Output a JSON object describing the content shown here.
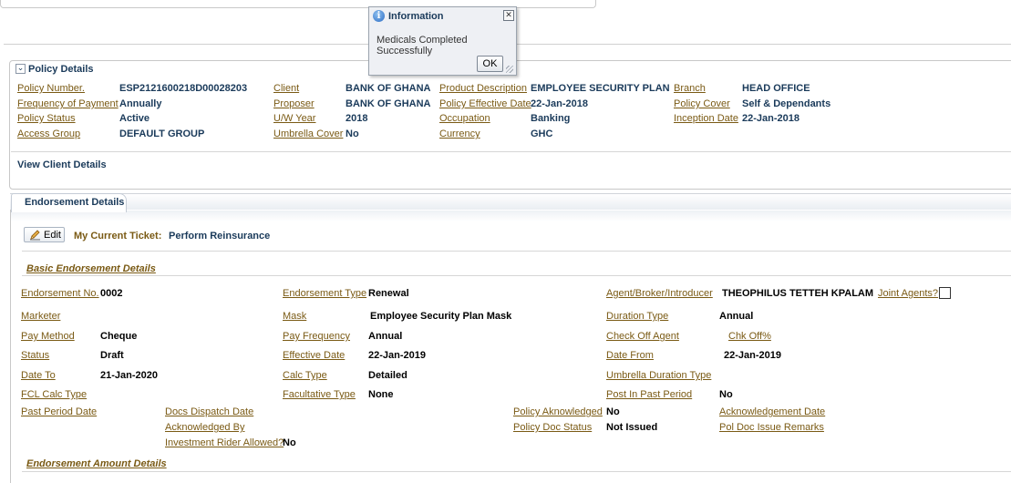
{
  "dialog": {
    "title": "Information",
    "message": "Medicals Completed Successfully",
    "ok_label": "OK",
    "close_glyph": "✕",
    "info_glyph": "i"
  },
  "policy_details": {
    "title": "Policy Details",
    "toggle_glyph": "⌄",
    "fields": {
      "policy_number": {
        "label": "Policy Number.",
        "value": "ESP2121600218D00028203"
      },
      "frequency_of_payment": {
        "label": "Frequency of Payment",
        "value": "Annually"
      },
      "policy_status": {
        "label": "Policy Status",
        "value": "Active"
      },
      "access_group": {
        "label": "Access Group",
        "value": "DEFAULT GROUP"
      },
      "client": {
        "label": "Client",
        "value": "BANK OF GHANA"
      },
      "proposer": {
        "label": "Proposer",
        "value": "BANK OF GHANA"
      },
      "uw_year": {
        "label": "U/W Year",
        "value": "2018"
      },
      "umbrella_cover": {
        "label": "Umbrella Cover",
        "value": "No"
      },
      "product_description": {
        "label": "Product Description",
        "value": "EMPLOYEE SECURITY PLAN"
      },
      "policy_effective_date": {
        "label": "Policy Effective Date",
        "value": "22-Jan-2018"
      },
      "occupation": {
        "label": "Occupation",
        "value": "Banking"
      },
      "currency": {
        "label": "Currency",
        "value": "GHC"
      },
      "branch": {
        "label": "Branch",
        "value": "HEAD OFFICE"
      },
      "policy_cover": {
        "label": "Policy Cover",
        "value": "Self & Dependants"
      },
      "inception_date": {
        "label": "Inception Date",
        "value": "22-Jan-2018"
      }
    },
    "view_client_link": "View Client Details"
  },
  "endorsement": {
    "tab_label": "Endorsement Details",
    "edit_label": "Edit",
    "ticket_label": "My Current Ticket:",
    "ticket_value": "Perform Reinsurance",
    "basic_title": "Basic Endorsement Details",
    "amount_title": "Endorsement Amount Details",
    "fields": {
      "endorsement_no": {
        "label": "Endorsement No.",
        "value": "0002"
      },
      "marketer": {
        "label": "Marketer",
        "value": ""
      },
      "pay_method": {
        "label": "Pay Method",
        "value": "Cheque"
      },
      "status": {
        "label": "Status",
        "value": "Draft"
      },
      "date_to": {
        "label": "Date To",
        "value": "21-Jan-2020"
      },
      "fcl_calc_type": {
        "label": "FCL Calc Type",
        "value": ""
      },
      "past_period_date": {
        "label": "Past Period Date",
        "value": ""
      },
      "endorsement_type": {
        "label": "Endorsement Type",
        "value": "Renewal"
      },
      "mask": {
        "label": "Mask",
        "value": "Employee Security Plan Mask"
      },
      "pay_frequency": {
        "label": "Pay Frequency",
        "value": "Annual"
      },
      "effective_date": {
        "label": "Effective Date",
        "value": "22-Jan-2019"
      },
      "calc_type": {
        "label": "Calc Type",
        "value": "Detailed"
      },
      "facultative_type": {
        "label": "Facultative Type",
        "value": "None"
      },
      "agent": {
        "label": "Agent/Broker/Introducer",
        "value": "THEOPHILUS TETTEH KPALAM"
      },
      "joint_agents": {
        "label": "Joint Agents?"
      },
      "duration_type": {
        "label": "Duration Type",
        "value": "Annual"
      },
      "check_off_agent": {
        "label": "Check Off Agent",
        "value": ""
      },
      "chk_off_pct": {
        "label": "Chk Off%"
      },
      "date_from": {
        "label": "Date From",
        "value": "22-Jan-2019"
      },
      "umbrella_duration_type": {
        "label": "Umbrella Duration Type",
        "value": ""
      },
      "post_in_past_period": {
        "label": "Post In Past Period",
        "value": "No"
      },
      "docs_dispatch_date": {
        "label": "Docs Dispatch Date",
        "value": ""
      },
      "acknowledged_by": {
        "label": "Acknowledged By",
        "value": ""
      },
      "investment_rider": {
        "label": "Investment Rider Allowed?",
        "value": "No"
      },
      "policy_aknowledged": {
        "label": "Policy Aknowledged",
        "value": "No"
      },
      "policy_doc_status": {
        "label": "Policy Doc Status",
        "value": "Not Issued"
      },
      "acknowledgement_date": {
        "label": "Acknowledgement Date",
        "value": ""
      },
      "pol_doc_issue_remarks": {
        "label": "Pol Doc Issue Remarks",
        "value": ""
      }
    }
  }
}
